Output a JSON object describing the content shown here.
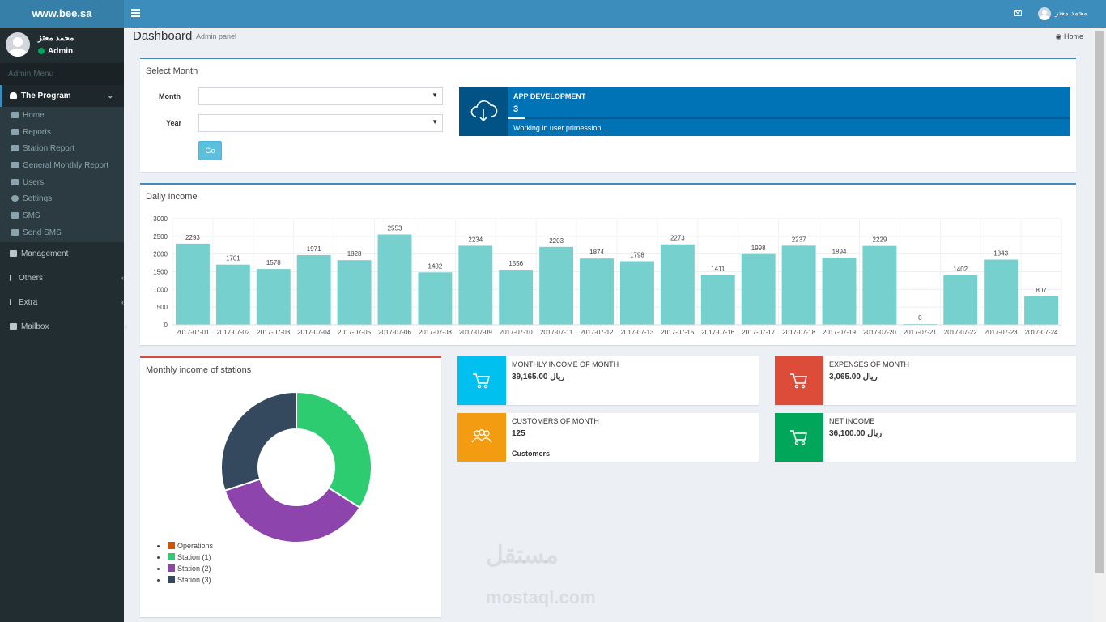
{
  "topbar": {
    "logo": "www.bee.sa",
    "user_name": "محمد معتز"
  },
  "sidebar": {
    "user_name": "محمد معتز",
    "user_role": "Admin",
    "header": "Admin Menu",
    "active_group": "The Program",
    "sub_items": [
      "Home",
      "Reports",
      "Station Report",
      "General Monthly Report",
      "Users",
      "Settings",
      "SMS",
      "Send SMS"
    ],
    "items": [
      "Management",
      "Others",
      "Extra",
      "Mailbox"
    ]
  },
  "page": {
    "title": "Dashboard",
    "subtitle": "Admin panel",
    "breadcrumb": "Home"
  },
  "select_month": {
    "title": "Select Month",
    "month_label": "Month",
    "year_label": "Year",
    "go_label": "Go"
  },
  "app_dev": {
    "title": "APP DEVELOPMENT",
    "value": "3",
    "description": "Working in user primession ...",
    "progress": 0.03
  },
  "daily_income": {
    "title": "Daily Income"
  },
  "chart_data": {
    "type": "bar",
    "title": "Daily Income",
    "categories": [
      "2017-07-01",
      "2017-07-02",
      "2017-07-03",
      "2017-07-04",
      "2017-07-05",
      "2017-07-06",
      "2017-07-08",
      "2017-07-09",
      "2017-07-10",
      "2017-07-11",
      "2017-07-12",
      "2017-07-13",
      "2017-07-15",
      "2017-07-16",
      "2017-07-17",
      "2017-07-18",
      "2017-07-19",
      "2017-07-20",
      "2017-07-21",
      "2017-07-22",
      "2017-07-23",
      "2017-07-24"
    ],
    "values": [
      2293,
      1701,
      1578,
      1971,
      1828,
      2553,
      1482,
      2234,
      1556,
      2203,
      1874,
      1798,
      2273,
      1411,
      1998,
      2237,
      1894,
      2229,
      0,
      1402,
      1843,
      807
    ],
    "ylim": [
      0,
      3000
    ],
    "yticks": [
      0,
      500,
      1000,
      1500,
      2000,
      2500,
      3000
    ],
    "bar_color": "#76d0ce",
    "grid": true
  },
  "stations": {
    "title": "Monthly income of stations",
    "legend": [
      {
        "label": "Operations",
        "color": "#d35400"
      },
      {
        "label": "Station (1)",
        "color": "#2ecc71"
      },
      {
        "label": "Station (2)",
        "color": "#8e44ad"
      },
      {
        "label": "Station (3)",
        "color": "#34495e"
      }
    ],
    "values": [
      0,
      34,
      36,
      30
    ]
  },
  "info_boxes": {
    "monthly_income": {
      "label": "MONTHLY INCOME OF MONTH",
      "value": "39,165.00 ريال",
      "color": "#00c0ef"
    },
    "expenses": {
      "label": "EXPENSES OF MONTH",
      "value": "3,065.00 ريال",
      "color": "#dd4b39"
    },
    "customers": {
      "label": "CUSTOMERS OF MONTH",
      "value": "125",
      "extra": "Customers",
      "color": "#f39c12"
    },
    "net_income": {
      "label": "NET INCOME",
      "value": "36,100.00 ريال",
      "color": "#00a65a"
    }
  },
  "watermark": {
    "arabic": "مستقل",
    "latin": "mostaql.com"
  }
}
